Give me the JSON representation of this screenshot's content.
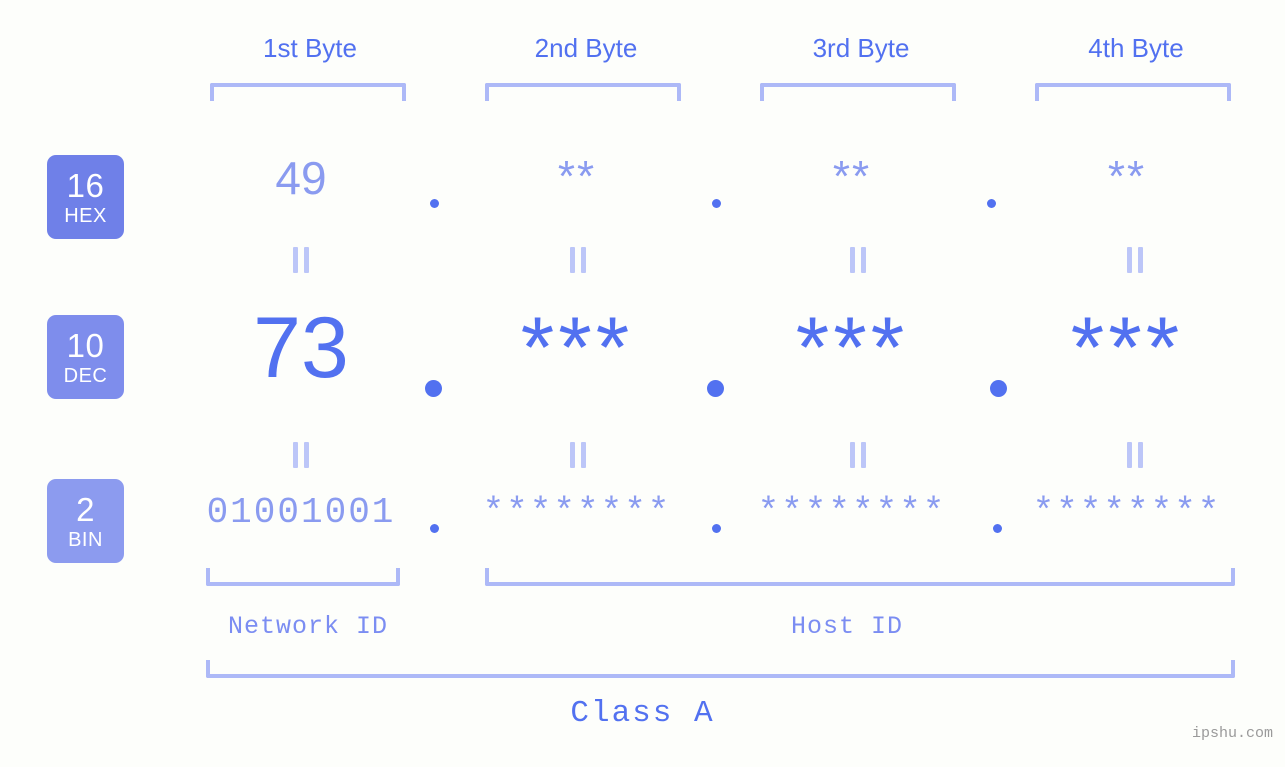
{
  "meta": {
    "background_color": "#fdfefb",
    "accent_strong": "#5271f0",
    "accent_light": "#8a9bf0",
    "bracket_color": "#adb9f7",
    "separator_color": "#bcc6f8",
    "watermark_color": "#9a9a9a"
  },
  "header": {
    "bytes": [
      {
        "label": "1st Byte"
      },
      {
        "label": "2nd Byte"
      },
      {
        "label": "3rd Byte"
      },
      {
        "label": "4th Byte"
      }
    ]
  },
  "bases": [
    {
      "number": "16",
      "abbr": "HEX",
      "color": "#6f80e8"
    },
    {
      "number": "10",
      "abbr": "DEC",
      "color": "#7e8dec"
    },
    {
      "number": "2",
      "abbr": "BIN",
      "color": "#8c9bef"
    }
  ],
  "rows": {
    "hex": {
      "base_number": "16",
      "base_abbr": "HEX",
      "values": [
        "49",
        "**",
        "**",
        "**"
      ],
      "separator": "."
    },
    "dec": {
      "base_number": "10",
      "base_abbr": "DEC",
      "values": [
        "73",
        "***",
        "***",
        "***"
      ],
      "separator": "."
    },
    "bin": {
      "base_number": "2",
      "base_abbr": "BIN",
      "values": [
        "01001001",
        "********",
        "********",
        "********"
      ],
      "separator": "."
    }
  },
  "equals_marks": {
    "glyph": "||",
    "count_per_gap": 4,
    "gaps": 2
  },
  "footer": {
    "network_id_label": "Network ID",
    "host_id_label": "Host ID",
    "class_label": "Class A",
    "watermark": "ipshu.com"
  }
}
